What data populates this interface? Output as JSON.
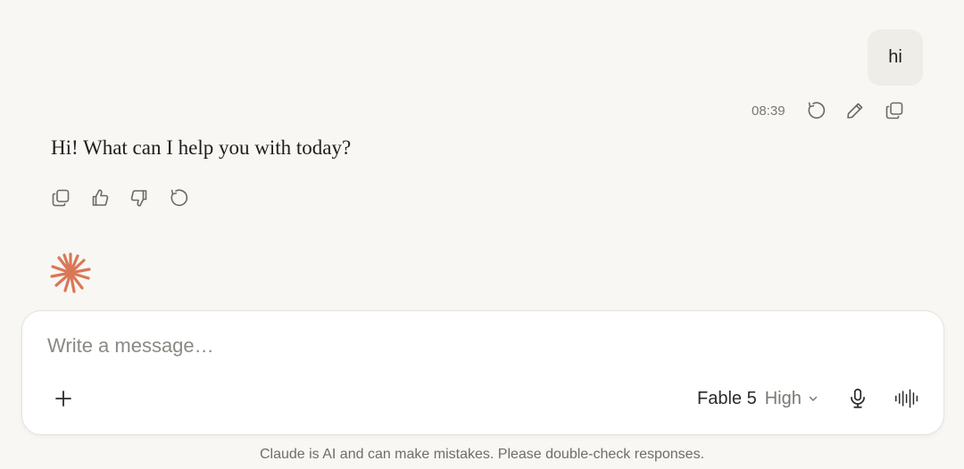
{
  "conversation": {
    "user_message": "hi",
    "user_timestamp": "08:39",
    "assistant_message": "Hi! What can I help you with today?"
  },
  "composer": {
    "placeholder": "Write a message…",
    "model_name": "Fable 5",
    "effort_level": "High"
  },
  "footer": {
    "disclaimer": "Claude is AI and can make mistakes. Please double-check responses."
  },
  "icons": {
    "user_actions": [
      "retry-icon",
      "edit-icon",
      "copy-icon"
    ],
    "assistant_actions": [
      "copy-icon",
      "thumbs-up-icon",
      "thumbs-down-icon",
      "retry-icon"
    ],
    "composer": [
      "plus-icon",
      "chevron-down-icon",
      "microphone-icon",
      "voice-waveform-icon"
    ],
    "brand": "spark-icon"
  },
  "colors": {
    "background": "#f8f7f4",
    "bubble": "#eeede8",
    "accent": "#d97757",
    "icon": "#6b6964"
  }
}
